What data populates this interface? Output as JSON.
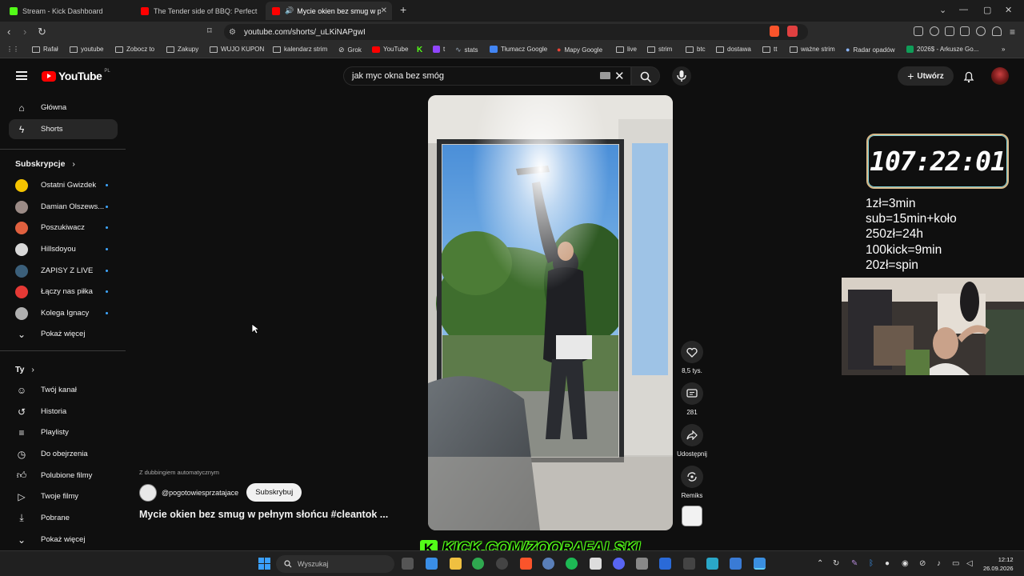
{
  "browser": {
    "tabs": [
      {
        "title": "Stream - Kick Dashboard",
        "color": "#53fc18"
      },
      {
        "title": "The Tender side of BBQ: Perfectly Sli",
        "color": "#ff0000"
      },
      {
        "title": "Mycie okien bez smug w pełn",
        "color": "#ff0000"
      }
    ],
    "url": "youtube.com/shorts/_uLKiNAPgwI",
    "bookmarks": [
      "Rafał",
      "youtube",
      "Zobocz to",
      "Zakupy",
      "WUJO KUPON",
      "kalendarz strim",
      "Grok",
      "YouTube",
      "t",
      "stats",
      "Tłumacz Google",
      "Mapy Google",
      "live",
      "strim",
      "btc",
      "dostawa",
      "tt",
      "ważne strim",
      "Radar opadów",
      "2026$ - Arkusze Go..."
    ]
  },
  "youtube": {
    "logo_text": "YouTube",
    "region": "PL",
    "search_value": "jak myc okna bez smóg",
    "create_label": "Utwórz",
    "sidebar": {
      "main": [
        "Główna",
        "Shorts"
      ],
      "subscriptions_header": "Subskrypcje",
      "subscriptions": [
        {
          "name": "Ostatni Gwizdek",
          "color": "#f5c400"
        },
        {
          "name": "Damian Olszews...",
          "color": "#9b8b86"
        },
        {
          "name": "Poszukiwacz",
          "color": "#e0603f"
        },
        {
          "name": "Hillsdoyou",
          "color": "#d8d8d8"
        },
        {
          "name": "ZAPISY Z LIVE",
          "color": "#3b5f7a"
        },
        {
          "name": "Łączy nas piłka",
          "color": "#e53935"
        },
        {
          "name": "Kolega Ignacy",
          "color": "#b0b0b0"
        }
      ],
      "show_more": "Pokaż więcej",
      "you_header": "Ty",
      "you_items": [
        "Twój kanał",
        "Historia",
        "Playlisty",
        "Do obejrzenia",
        "Polubione filmy",
        "Twoje filmy",
        "Pobrane",
        "Pokaż więcej"
      ]
    },
    "short": {
      "dubbing": "Z dubbingiem automatycznym",
      "channel": "@pogotowiesprzatajace",
      "subscribe_label": "Subskrybuj",
      "title": "Mycie okien bez smug w pełnym słońcu #cleantok ...",
      "likes": "8,5 tys.",
      "comments": "281",
      "share": "Udostępnij",
      "remix": "Remiks"
    }
  },
  "overlay": {
    "timer": "107:22:01",
    "rules": [
      "1zł=3min",
      "sub=15min+koło",
      "250zł=24h",
      "100kick=9min",
      "20zł=spin"
    ],
    "kick_url": "KICK.COM/ZOORAFALSKI",
    "kick_color": "#53fc18"
  },
  "taskbar": {
    "search_placeholder": "Wyszukaj",
    "time": "12:12",
    "date": "26.09.2026"
  }
}
